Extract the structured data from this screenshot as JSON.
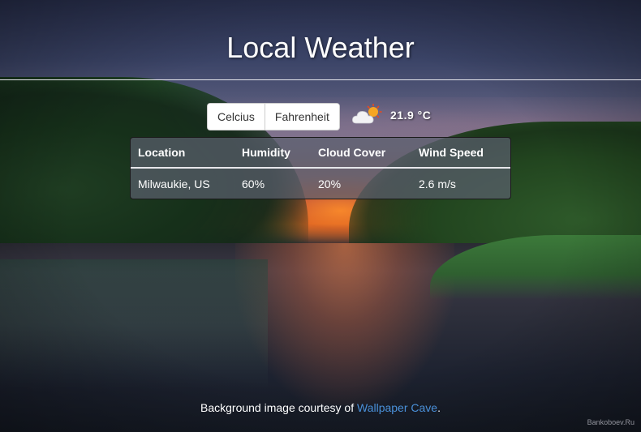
{
  "header": {
    "title": "Local Weather"
  },
  "units": {
    "celsius_label": "Celcius",
    "fahrenheit_label": "Fahrenheit"
  },
  "current": {
    "icon": "partly-cloudy-icon",
    "temperature": "21.9 °C"
  },
  "table": {
    "headers": [
      "Location",
      "Humidity",
      "Cloud Cover",
      "Wind Speed"
    ],
    "rows": [
      [
        "Milwaukie, US",
        "60%",
        "20%",
        "2.6 m/s"
      ]
    ]
  },
  "footer": {
    "prefix": "Background image courtesy of ",
    "link_text": "Wallpaper Cave",
    "suffix": "."
  },
  "watermark": "Bankoboev.Ru",
  "colors": {
    "link": "#4a90d9",
    "divider": "#e8e8ee",
    "sun": "#f5a623"
  }
}
